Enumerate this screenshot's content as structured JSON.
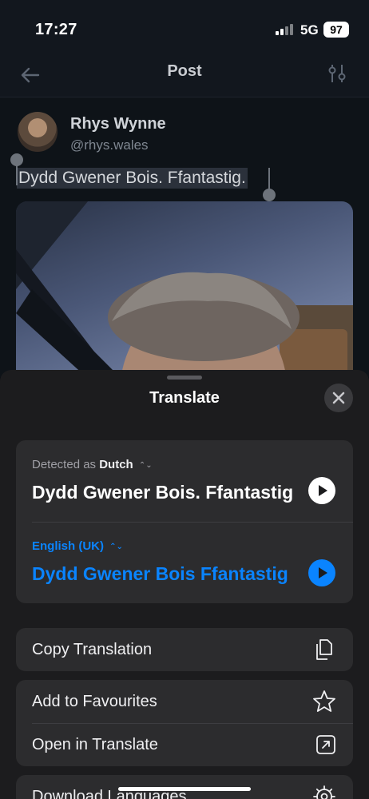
{
  "status_bar": {
    "time": "17:27",
    "network": "5G",
    "battery": "97"
  },
  "nav": {
    "title": "Post",
    "back_icon": "arrow-left-icon",
    "filter_icon": "sliders-icon"
  },
  "post": {
    "author_name": "Rhys Wynne",
    "author_handle": "@rhys.wales",
    "text": "Dydd Gwener Bois. Ffantastig."
  },
  "translate_sheet": {
    "title": "Translate",
    "detected_prefix": "Detected as",
    "detected_language": "Dutch",
    "source_text": "Dydd Gwener Bois. Ffantastig",
    "target_language": "English (UK)",
    "translated_text": "Dydd Gwener Bois Ffantastig",
    "actions": {
      "copy": "Copy Translation",
      "favourites": "Add to Favourites",
      "open": "Open in Translate",
      "download": "Download Languages"
    }
  },
  "colors": {
    "accent": "#0a84ff",
    "sheet_bg": "#1c1c1e",
    "card_bg": "#2c2c2e"
  }
}
